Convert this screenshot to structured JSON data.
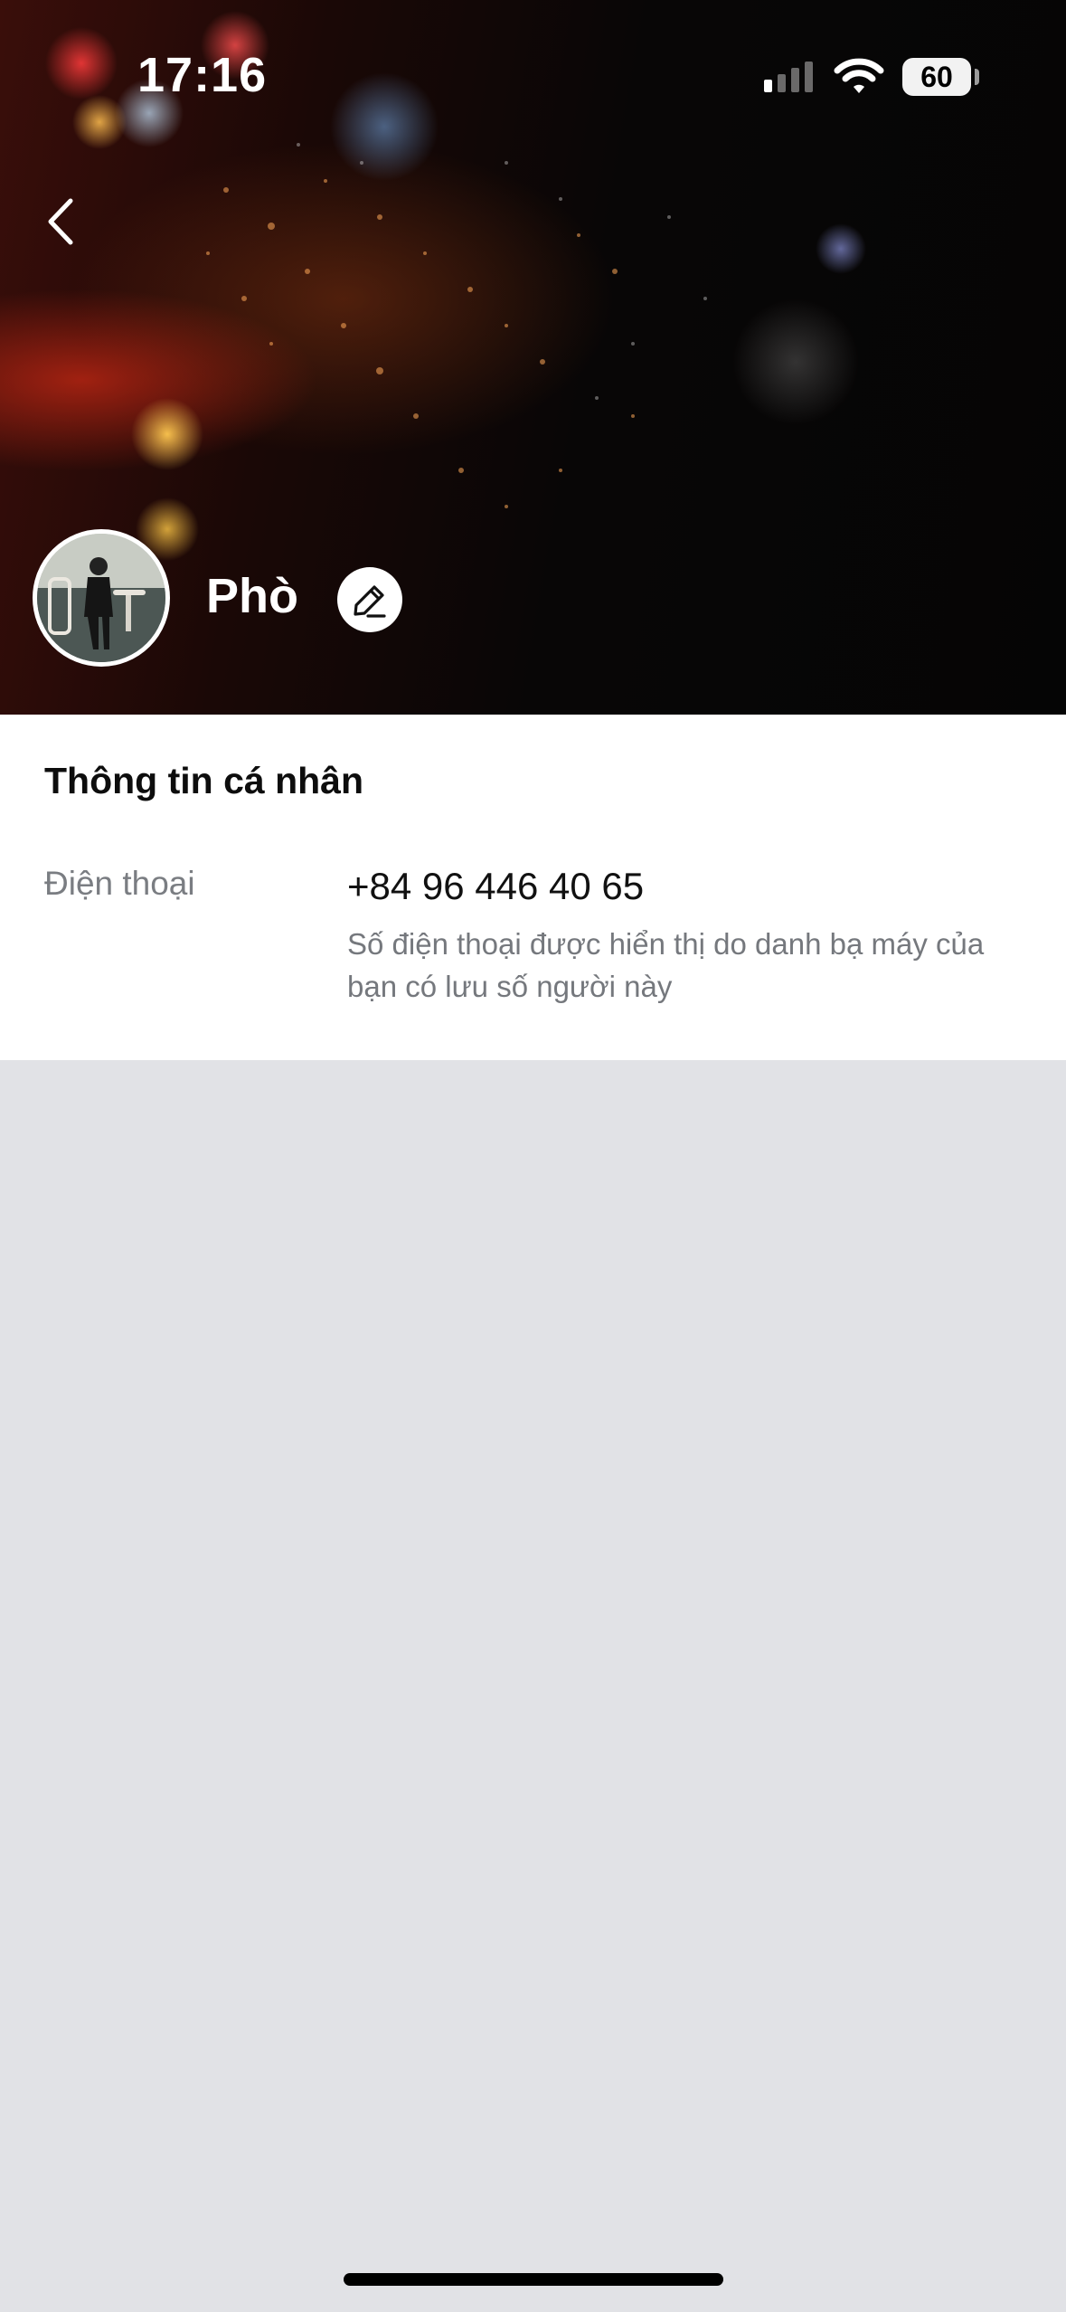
{
  "status_bar": {
    "time": "17:16",
    "battery": "60"
  },
  "profile": {
    "name": "Phò"
  },
  "personal_info": {
    "title": "Thông tin cá nhân",
    "phone_label": "Điện thoại",
    "phone_value": "+84 96 446 40 65",
    "phone_note": "Số điện thoại được hiển thị do danh bạ máy của bạn có lưu số người này"
  },
  "colors": {
    "background": "#e1e2e6",
    "card": "#ffffff",
    "label_gray": "#7a7d82"
  },
  "icons": {
    "back": "chevron-left-icon",
    "edit": "pencil-icon",
    "signal": "cellular-signal-icon",
    "wifi": "wifi-icon",
    "battery": "battery-icon"
  }
}
